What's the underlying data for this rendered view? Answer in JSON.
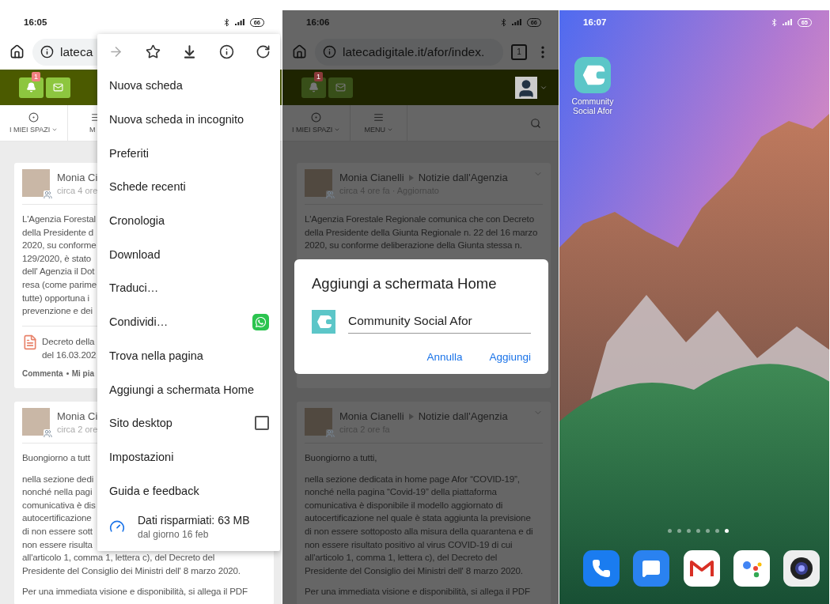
{
  "menu_screen": {
    "status": {
      "time": "16:05",
      "battery": "66"
    },
    "address": {
      "url": "lateca"
    },
    "header": {
      "badge": "1"
    },
    "nav": [
      {
        "kind": "spaces",
        "label": "I MIEI SPAZI"
      },
      {
        "kind": "menu",
        "label": "M"
      }
    ],
    "posts": [
      {
        "author": "Monia Ci",
        "time": "circa 4 ore",
        "paragraphs": [
          [
            "L'Agenzia Forestal",
            "della Presidente d",
            "2020, su conforme",
            "129/2020, è stato",
            "dell' Agenzia il Dot",
            "resa (come parime",
            "tutte) opportuna i",
            "prevenzione e dei"
          ]
        ],
        "attachment": [
          "Decreto della",
          "del 16.03.202"
        ],
        "actions": [
          "Commenta",
          "Mi pia"
        ]
      },
      {
        "author": "Monia Ci",
        "time": "circa 2 ore",
        "paragraphs": [
          [
            "Buongiorno a tutt"
          ],
          [
            "nella sezione dedi",
            "nonché nella pagi",
            "comunicativa è dis",
            "autocertificazione",
            "di non essere sott",
            "non essere risulta",
            "all'articolo 1, comma 1, lettera c), del Decreto del",
            "Presidente del Consiglio dei Ministri dell' 8 marzo 2020."
          ],
          [
            "Per una immediata visione e disponibilità, si allega il PDF"
          ]
        ]
      }
    ],
    "menu": {
      "toolbar": [
        {
          "kind": "forward",
          "disabled": true
        },
        {
          "kind": "bookmark",
          "disabled": false
        },
        {
          "kind": "download",
          "disabled": false
        },
        {
          "kind": "info",
          "disabled": false
        },
        {
          "kind": "refresh",
          "disabled": false
        }
      ],
      "items": [
        {
          "kind": "plain",
          "label": "Nuova scheda"
        },
        {
          "kind": "plain",
          "label": "Nuova scheda in incognito"
        },
        {
          "kind": "plain",
          "label": "Preferiti"
        },
        {
          "kind": "plain",
          "label": "Schede recenti"
        },
        {
          "kind": "plain",
          "label": "Cronologia"
        },
        {
          "kind": "plain",
          "label": "Download"
        },
        {
          "kind": "plain",
          "label": "Traduci…"
        },
        {
          "kind": "share",
          "label": "Condividi…"
        },
        {
          "kind": "plain",
          "label": "Trova nella pagina"
        },
        {
          "kind": "plain",
          "label": "Aggiungi a schermata Home"
        },
        {
          "kind": "checkbox",
          "label": "Sito desktop",
          "checked": false
        },
        {
          "kind": "plain",
          "label": "Impostazioni"
        },
        {
          "kind": "plain",
          "label": "Guida e feedback"
        },
        {
          "kind": "saver",
          "label": "Dati risparmiati: 63 MB",
          "sublabel": "dal giorno 16 feb"
        }
      ]
    }
  },
  "dialog_screen": {
    "status": {
      "time": "16:06",
      "battery": "66"
    },
    "address": {
      "url": "latecadigitale.it/afor/index.",
      "tabs": "1"
    },
    "header": {
      "badge": "1"
    },
    "nav": [
      {
        "kind": "spaces",
        "label": "I MIEI SPAZI"
      },
      {
        "kind": "menu",
        "label": "MENU"
      }
    ],
    "posts": [
      {
        "author": "Monia Cianelli",
        "group": "Notizie dall'Agenzia",
        "time": "circa 4 ore fa · Aggiornato",
        "paragraphs": [
          [
            "L'Agenzia Forestale Regionale comunica che con Decreto",
            "della Presidente della Giunta Regionale n. 22 del 16 marzo",
            "2020, su conforme deliberazione della Giunta stessa n."
          ]
        ]
      },
      {
        "author": "Monia Cianelli",
        "group": "Notizie dall'Agenzia",
        "time": "circa 2 ore fa",
        "paragraphs": [
          [
            "Buongiorno a tutti,"
          ],
          [
            "nella sezione dedicata in home page Afor “COVID-19”,",
            "nonché nella pagina “Covid-19” della piattaforma",
            "comunicativa è disponibile il modello aggiornato di",
            "autocertificazione nel quale è stata aggiunta la previsione",
            "di non essere sottoposto alla misura della quarantena e di",
            "non essere risultato positivo al virus COVID-19 di cui",
            "all'articolo 1, comma 1, lettera c), del Decreto del",
            "Presidente del Consiglio dei Ministri dell' 8 marzo 2020."
          ],
          [
            "Per una immediata visione e disponibilità, si allega il PDF"
          ]
        ]
      }
    ],
    "dialog": {
      "title": "Aggiungi a schermata Home",
      "value": "Community Social Afor",
      "buttons": [
        "Annulla",
        "Aggiungi"
      ]
    }
  },
  "home_screen": {
    "status": {
      "time": "16:07",
      "battery": "65"
    },
    "apps": [
      {
        "label": "Community Social Afor"
      }
    ],
    "page_dots": [
      {
        "selected": false
      },
      {
        "selected": false
      },
      {
        "selected": false
      },
      {
        "selected": false
      },
      {
        "selected": false
      },
      {
        "selected": false
      },
      {
        "selected": true
      }
    ],
    "dock": [
      {
        "kind": "phone"
      },
      {
        "kind": "messages"
      },
      {
        "kind": "mail"
      },
      {
        "kind": "assistant"
      },
      {
        "kind": "camera"
      }
    ]
  }
}
